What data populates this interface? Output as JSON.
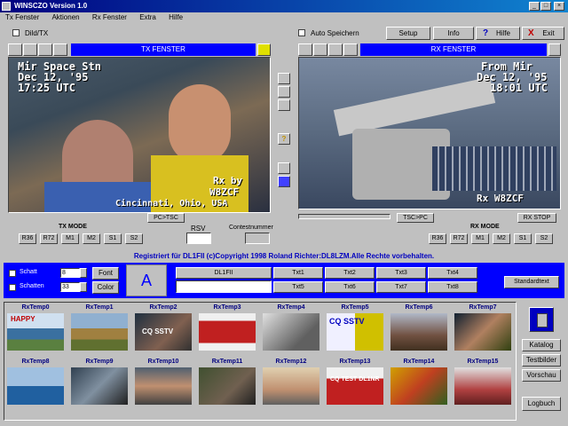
{
  "window": {
    "title": "WINSCZO Version 1.0",
    "buttons": [
      "_",
      "□",
      "×"
    ]
  },
  "menu": [
    "Tx Fenster",
    "Aktionen",
    "Rx Fenster",
    "Extra",
    "Hilfe"
  ],
  "toolbar": {
    "dild_tx": "Dild/TX",
    "auto_save": "Auto Speichern",
    "setup": "Setup",
    "info": "Info",
    "help": "Hilfe",
    "exit": "Exit"
  },
  "tx": {
    "header": "TX FENSTER",
    "line1": "Mir Space Stn",
    "line2": "Dec 12, '95",
    "line3": "17:25 UTC",
    "caption1": "Rx by",
    "caption2": "W8ZCF",
    "caption3": "Cincinnati, Ohio, USA",
    "button": "PC>TSC",
    "mode_label": "TX MODE",
    "modes": [
      "R36",
      "R72",
      "M1",
      "M2",
      "S1",
      "S2"
    ]
  },
  "rx": {
    "header": "RX FENSTER",
    "line1": "From Mir",
    "line2": "Dec 12, '95",
    "line3": "18:01 UTC",
    "caption": "Rx W8ZCF",
    "tsc_button": "TSC>PC",
    "stop_button": "RX STOP",
    "mode_label": "RX MODE",
    "modes": [
      "R36",
      "R72",
      "M1",
      "M2",
      "S1",
      "S2"
    ]
  },
  "rsv_label": "RSV",
  "contest_label": "Contestnummer",
  "copyright": "Registriert für DL1FII   (c)Copyright 1998 Roland Richter:DL8LZM.Alle Rechte vorbehalten.",
  "text_panel": {
    "check1": "Schatt",
    "check2": "Schatten",
    "val1": "8",
    "val2": "33",
    "font_btn": "Font",
    "color_btn": "Color",
    "preview": "A",
    "callsign": "DL1FII",
    "cells": [
      "Txt1",
      "Txt2",
      "Txt3",
      "Txt4",
      "Txt5",
      "Txt6",
      "Txt7",
      "Txt8"
    ],
    "std_btn": "Standardtext"
  },
  "thumbs_row1": [
    "RxTemp0",
    "RxTemp1",
    "RxTemp2",
    "RxTemp3",
    "RxTemp4",
    "RxTemp5",
    "RxTemp6",
    "RxTemp7"
  ],
  "thumbs_row2": [
    "RxTemp8",
    "RxTemp9",
    "RxTemp10",
    "RxTemp11",
    "RxTemp12",
    "RxTemp13",
    "RxTemp14",
    "RxTemp15"
  ],
  "thumb_texts": {
    "t0": "HAPPY",
    "t2": "CQ SSTV",
    "t5": "CQ SSTV",
    "t13": "CQ TEST DL1NR"
  },
  "side_buttons": {
    "katalog": "Katalog",
    "testbilder": "Testbilder",
    "vorschau": "Vorschau",
    "logbuch": "Logbuch"
  }
}
